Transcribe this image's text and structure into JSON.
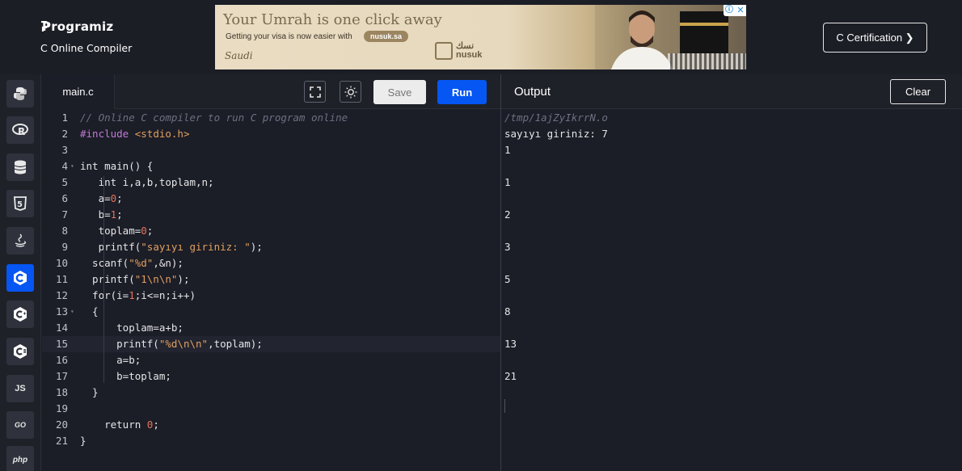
{
  "header": {
    "brand_name": "Programiz",
    "brand_subtitle": "C Online Compiler",
    "certification_button": "C Certification ❯"
  },
  "ad": {
    "headline": "Your Umrah is one click away",
    "subline": "Getting your visa is now easier with",
    "pill": "nusuk.sa",
    "script_logo": "Saudi",
    "brand": "nusuk",
    "brand_arabic": "نسك",
    "info_icon": "ⓘ",
    "close_icon": "✕"
  },
  "sidebar": {
    "languages": [
      {
        "name": "python",
        "icon": "python-icon"
      },
      {
        "name": "r",
        "icon": "r-icon"
      },
      {
        "name": "sql",
        "icon": "database-icon"
      },
      {
        "name": "html",
        "icon": "html5-icon"
      },
      {
        "name": "java",
        "icon": "java-icon"
      },
      {
        "name": "c",
        "icon": "c-icon",
        "active": true
      },
      {
        "name": "cpp",
        "icon": "cpp-icon"
      },
      {
        "name": "csharp",
        "icon": "csharp-icon"
      },
      {
        "name": "javascript",
        "icon": "js-icon",
        "label": "JS"
      },
      {
        "name": "go",
        "icon": "go-icon",
        "label": "GO"
      },
      {
        "name": "php",
        "icon": "php-icon",
        "label": "php"
      }
    ]
  },
  "editor": {
    "tab_label": "main.c",
    "save_label": "Save",
    "run_label": "Run",
    "fullscreen_icon": "fullscreen-icon",
    "theme_icon": "sun-icon",
    "current_line": 15,
    "lines": [
      {
        "n": "1",
        "fold": false,
        "html": "<span class=\"cm\">// Online C compiler to run C program online</span>"
      },
      {
        "n": "2",
        "fold": false,
        "html": "<span class=\"inc\">#include</span> <span class=\"str\">&lt;stdio.h&gt;</span>"
      },
      {
        "n": "3",
        "fold": false,
        "html": ""
      },
      {
        "n": "4",
        "fold": true,
        "html": "int main() {"
      },
      {
        "n": "5",
        "fold": false,
        "html": "   int i,a,b,toplam,n;"
      },
      {
        "n": "6",
        "fold": false,
        "html": "   a=<span class=\"num\">0</span>;"
      },
      {
        "n": "7",
        "fold": false,
        "html": "   b=<span class=\"num\">1</span>;"
      },
      {
        "n": "8",
        "fold": false,
        "html": "   toplam=<span class=\"num\">0</span>;"
      },
      {
        "n": "9",
        "fold": false,
        "html": "   printf(<span class=\"str\">\"sayıyı giriniz: \"</span>);"
      },
      {
        "n": "10",
        "fold": false,
        "html": "  scanf(<span class=\"str\">\"%d\"</span>,&amp;n);"
      },
      {
        "n": "11",
        "fold": false,
        "html": "  printf(<span class=\"str\">\"1\\n\\n\"</span>);"
      },
      {
        "n": "12",
        "fold": false,
        "html": "  for(i=<span class=\"num\">1</span>;i&lt;=n;i++)"
      },
      {
        "n": "13",
        "fold": true,
        "html": "  {"
      },
      {
        "n": "14",
        "fold": false,
        "html": "      toplam=a+b;"
      },
      {
        "n": "15",
        "fold": false,
        "html": "      printf(<span class=\"str\">\"%d\\n\\n\"</span>,toplam);"
      },
      {
        "n": "16",
        "fold": false,
        "html": "      a=b;"
      },
      {
        "n": "17",
        "fold": false,
        "html": "      b=toplam;"
      },
      {
        "n": "18",
        "fold": false,
        "html": "  }"
      },
      {
        "n": "19",
        "fold": false,
        "html": ""
      },
      {
        "n": "20",
        "fold": false,
        "html": "    return <span class=\"num\">0</span>;"
      },
      {
        "n": "21",
        "fold": false,
        "html": "}"
      }
    ]
  },
  "output": {
    "title": "Output",
    "clear_label": "Clear",
    "path": "/tmp/1ajZyIkrrN.o",
    "lines": [
      "sayıyı giriniz: 7",
      "1",
      "",
      "1",
      "",
      "2",
      "",
      "3",
      "",
      "5",
      "",
      "8",
      "",
      "13",
      "",
      "21"
    ]
  }
}
